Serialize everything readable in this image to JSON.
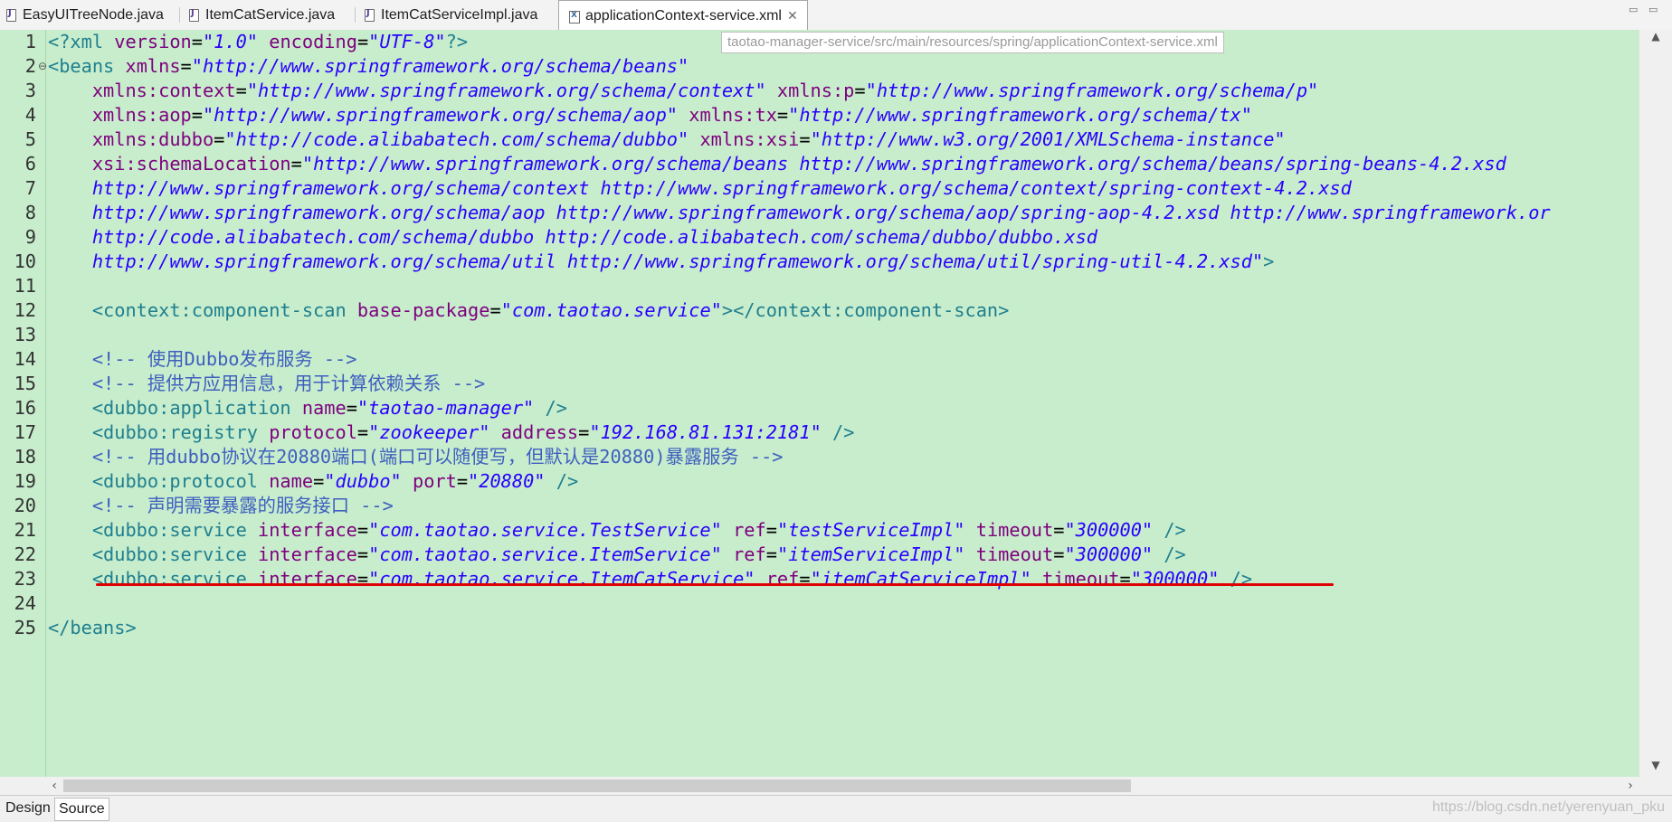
{
  "tabs": [
    {
      "label": "EasyUITreeNode.java",
      "icon": "java-file-icon"
    },
    {
      "label": "ItemCatService.java",
      "icon": "java-file-icon"
    },
    {
      "label": "ItemCatServiceImpl.java",
      "icon": "java-file-icon"
    },
    {
      "label": "applicationContext-service.xml",
      "icon": "xml-file-icon",
      "active": true
    }
  ],
  "window_controls": {
    "minimize": "▭",
    "maximize": "▭"
  },
  "path_hint": "taotao-manager-service/src/main/resources/spring/applicationContext-service.xml",
  "code_lines": [
    [
      {
        "t": "tag",
        "s": "<?xml "
      },
      {
        "t": "attr",
        "s": "version"
      },
      {
        "t": "txt",
        "s": "="
      },
      {
        "t": "val",
        "s": "\"1.0\""
      },
      {
        "t": "txt",
        "s": " "
      },
      {
        "t": "attr",
        "s": "encoding"
      },
      {
        "t": "txt",
        "s": "="
      },
      {
        "t": "val",
        "s": "\"UTF-8\""
      },
      {
        "t": "tag",
        "s": "?>"
      }
    ],
    [
      {
        "t": "tag",
        "s": "<beans "
      },
      {
        "t": "attr",
        "s": "xmlns"
      },
      {
        "t": "txt",
        "s": "="
      },
      {
        "t": "val",
        "s": "\"http://www.springframework.org/schema/beans\""
      }
    ],
    [
      {
        "t": "txt",
        "s": "    "
      },
      {
        "t": "attr",
        "s": "xmlns:context"
      },
      {
        "t": "txt",
        "s": "="
      },
      {
        "t": "val",
        "s": "\"http://www.springframework.org/schema/context\""
      },
      {
        "t": "txt",
        "s": " "
      },
      {
        "t": "attr",
        "s": "xmlns:p"
      },
      {
        "t": "txt",
        "s": "="
      },
      {
        "t": "val",
        "s": "\"http://www.springframework.org/schema/p\""
      }
    ],
    [
      {
        "t": "txt",
        "s": "    "
      },
      {
        "t": "attr",
        "s": "xmlns:aop"
      },
      {
        "t": "txt",
        "s": "="
      },
      {
        "t": "val",
        "s": "\"http://www.springframework.org/schema/aop\""
      },
      {
        "t": "txt",
        "s": " "
      },
      {
        "t": "attr",
        "s": "xmlns:tx"
      },
      {
        "t": "txt",
        "s": "="
      },
      {
        "t": "val",
        "s": "\"http://www.springframework.org/schema/tx\""
      }
    ],
    [
      {
        "t": "txt",
        "s": "    "
      },
      {
        "t": "attr",
        "s": "xmlns:dubbo"
      },
      {
        "t": "txt",
        "s": "="
      },
      {
        "t": "val",
        "s": "\"http://code.alibabatech.com/schema/dubbo\""
      },
      {
        "t": "txt",
        "s": " "
      },
      {
        "t": "attr",
        "s": "xmlns:xsi"
      },
      {
        "t": "txt",
        "s": "="
      },
      {
        "t": "val",
        "s": "\"http://www.w3.org/2001/XMLSchema-instance\""
      }
    ],
    [
      {
        "t": "txt",
        "s": "    "
      },
      {
        "t": "attr",
        "s": "xsi:schemaLocation"
      },
      {
        "t": "txt",
        "s": "="
      },
      {
        "t": "val",
        "s": "\"http://www.springframework.org/schema/beans http://www.springframework.org/schema/beans/spring-beans-4.2.xsd"
      }
    ],
    [
      {
        "t": "txt",
        "s": "    "
      },
      {
        "t": "val",
        "s": "http://www.springframework.org/schema/context http://www.springframework.org/schema/context/spring-context-4.2.xsd"
      }
    ],
    [
      {
        "t": "txt",
        "s": "    "
      },
      {
        "t": "val",
        "s": "http://www.springframework.org/schema/aop http://www.springframework.org/schema/aop/spring-aop-4.2.xsd http://www.springframework.or"
      }
    ],
    [
      {
        "t": "txt",
        "s": "    "
      },
      {
        "t": "val",
        "s": "http://code.alibabatech.com/schema/dubbo http://code.alibabatech.com/schema/dubbo/dubbo.xsd"
      }
    ],
    [
      {
        "t": "txt",
        "s": "    "
      },
      {
        "t": "val",
        "s": "http://www.springframework.org/schema/util http://www.springframework.org/schema/util/spring-util-4.2.xsd\""
      },
      {
        "t": "tag",
        "s": ">"
      }
    ],
    [],
    [
      {
        "t": "txt",
        "s": "    "
      },
      {
        "t": "tag",
        "s": "<context:component-scan "
      },
      {
        "t": "attr",
        "s": "base-package"
      },
      {
        "t": "txt",
        "s": "="
      },
      {
        "t": "val",
        "s": "\"com.taotao.service\""
      },
      {
        "t": "tag",
        "s": "></context:component-scan>"
      }
    ],
    [],
    [
      {
        "t": "txt",
        "s": "    "
      },
      {
        "t": "cm",
        "s": "<!-- 使用Dubbo发布服务 -->"
      }
    ],
    [
      {
        "t": "txt",
        "s": "    "
      },
      {
        "t": "cm",
        "s": "<!-- 提供方应用信息，用于计算依赖关系 -->"
      }
    ],
    [
      {
        "t": "txt",
        "s": "    "
      },
      {
        "t": "tag",
        "s": "<dubbo:application "
      },
      {
        "t": "attr",
        "s": "name"
      },
      {
        "t": "txt",
        "s": "="
      },
      {
        "t": "val",
        "s": "\"taotao-manager\""
      },
      {
        "t": "txt",
        "s": " "
      },
      {
        "t": "tag",
        "s": "/>"
      }
    ],
    [
      {
        "t": "txt",
        "s": "    "
      },
      {
        "t": "tag",
        "s": "<dubbo:registry "
      },
      {
        "t": "attr",
        "s": "protocol"
      },
      {
        "t": "txt",
        "s": "="
      },
      {
        "t": "val",
        "s": "\"zookeeper\""
      },
      {
        "t": "txt",
        "s": " "
      },
      {
        "t": "attr",
        "s": "address"
      },
      {
        "t": "txt",
        "s": "="
      },
      {
        "t": "val",
        "s": "\"192.168.81.131:2181\""
      },
      {
        "t": "txt",
        "s": " "
      },
      {
        "t": "tag",
        "s": "/>"
      }
    ],
    [
      {
        "t": "txt",
        "s": "    "
      },
      {
        "t": "cm",
        "s": "<!-- 用dubbo协议在20880端口(端口可以随便写，但默认是20880)暴露服务 -->"
      }
    ],
    [
      {
        "t": "txt",
        "s": "    "
      },
      {
        "t": "tag",
        "s": "<dubbo:protocol "
      },
      {
        "t": "attr",
        "s": "name"
      },
      {
        "t": "txt",
        "s": "="
      },
      {
        "t": "val",
        "s": "\"dubbo\""
      },
      {
        "t": "txt",
        "s": " "
      },
      {
        "t": "attr",
        "s": "port"
      },
      {
        "t": "txt",
        "s": "="
      },
      {
        "t": "val",
        "s": "\"20880\""
      },
      {
        "t": "txt",
        "s": " "
      },
      {
        "t": "tag",
        "s": "/>"
      }
    ],
    [
      {
        "t": "txt",
        "s": "    "
      },
      {
        "t": "cm",
        "s": "<!-- 声明需要暴露的服务接口 -->"
      }
    ],
    [
      {
        "t": "txt",
        "s": "    "
      },
      {
        "t": "tag",
        "s": "<dubbo:service "
      },
      {
        "t": "attr",
        "s": "interface"
      },
      {
        "t": "txt",
        "s": "="
      },
      {
        "t": "val",
        "s": "\"com.taotao.service.TestService\""
      },
      {
        "t": "txt",
        "s": " "
      },
      {
        "t": "attr",
        "s": "ref"
      },
      {
        "t": "txt",
        "s": "="
      },
      {
        "t": "val",
        "s": "\"testServiceImpl\""
      },
      {
        "t": "txt",
        "s": " "
      },
      {
        "t": "attr",
        "s": "timeout"
      },
      {
        "t": "txt",
        "s": "="
      },
      {
        "t": "val",
        "s": "\"300000\""
      },
      {
        "t": "txt",
        "s": " "
      },
      {
        "t": "tag",
        "s": "/>"
      }
    ],
    [
      {
        "t": "txt",
        "s": "    "
      },
      {
        "t": "tag",
        "s": "<dubbo:service "
      },
      {
        "t": "attr",
        "s": "interface"
      },
      {
        "t": "txt",
        "s": "="
      },
      {
        "t": "val",
        "s": "\"com.taotao.service.ItemService\""
      },
      {
        "t": "txt",
        "s": " "
      },
      {
        "t": "attr",
        "s": "ref"
      },
      {
        "t": "txt",
        "s": "="
      },
      {
        "t": "val",
        "s": "\"itemServiceImpl\""
      },
      {
        "t": "txt",
        "s": " "
      },
      {
        "t": "attr",
        "s": "timeout"
      },
      {
        "t": "txt",
        "s": "="
      },
      {
        "t": "val",
        "s": "\"300000\""
      },
      {
        "t": "txt",
        "s": " "
      },
      {
        "t": "tag",
        "s": "/>"
      }
    ],
    [
      {
        "t": "txt",
        "s": "    "
      },
      {
        "t": "tag",
        "s": "<dubbo:service "
      },
      {
        "t": "attr",
        "s": "interface"
      },
      {
        "t": "txt",
        "s": "="
      },
      {
        "t": "val",
        "s": "\"com.taotao.service.ItemCatService\""
      },
      {
        "t": "txt",
        "s": " "
      },
      {
        "t": "attr",
        "s": "ref"
      },
      {
        "t": "txt",
        "s": "="
      },
      {
        "t": "val",
        "s": "\"itemCatServiceImpl\""
      },
      {
        "t": "txt",
        "s": " "
      },
      {
        "t": "attr",
        "s": "timeout"
      },
      {
        "t": "txt",
        "s": "="
      },
      {
        "t": "val",
        "s": "\"300000\""
      },
      {
        "t": "txt",
        "s": " "
      },
      {
        "t": "tag",
        "s": "/>"
      }
    ],
    [],
    [
      {
        "t": "tag",
        "s": "</beans>"
      }
    ]
  ],
  "colors": {
    "editor_bg": "#c7edcc",
    "tag": "#1f7f8f",
    "attribute": "#7f007f",
    "value": "#2a00ff",
    "comment": "#3f5fbf",
    "highlight_underline": "#e00000"
  },
  "bottom_tabs": [
    {
      "label": "Design"
    },
    {
      "label": "Source",
      "active": true
    }
  ],
  "watermark": "https://blog.csdn.net/yerenyuan_pku"
}
